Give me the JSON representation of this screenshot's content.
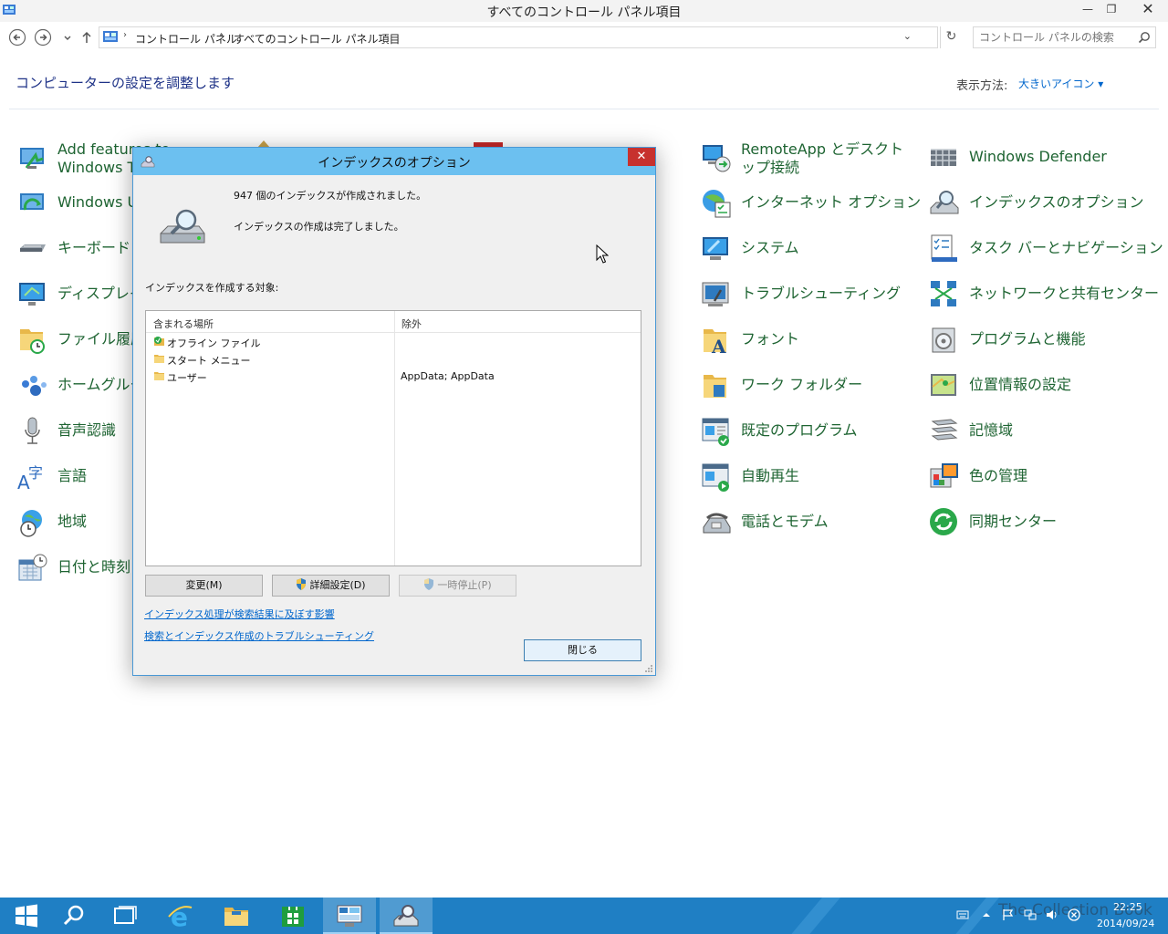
{
  "window": {
    "title": "すべてのコントロール パネル項目",
    "minimize": "—",
    "restore": "❐",
    "close": "✕"
  },
  "address": {
    "crumbs": [
      "コントロール パネル",
      "すべてのコントロール パネル項目"
    ],
    "separator": "›",
    "search_placeholder": "コントロール パネルの検索"
  },
  "header": {
    "heading": "コンピューターの設定を調整します",
    "view_by_label": "表示方法:",
    "view_by_value": "大きいアイコン ▾"
  },
  "items_left": [
    {
      "label": "Add features to Windows Technical Pr",
      "icon": "add-features-icon"
    },
    {
      "label": "Windows Up",
      "icon": "windows-update-icon"
    },
    {
      "label": "キーボード",
      "icon": "keyboard-icon"
    },
    {
      "label": "ディスプレイ",
      "icon": "display-icon"
    },
    {
      "label": "ファイル履歴",
      "icon": "file-history-icon"
    },
    {
      "label": "ホームグループ",
      "icon": "homegroup-icon"
    },
    {
      "label": "音声認識",
      "icon": "microphone-icon"
    },
    {
      "label": "言語",
      "icon": "language-icon"
    },
    {
      "label": "地域",
      "icon": "region-icon"
    },
    {
      "label": "日付と時刻",
      "icon": "date-time-icon"
    }
  ],
  "items_col3": [
    {
      "label": "RemoteApp とデスクトップ接続",
      "icon": "remoteapp-icon"
    },
    {
      "label": "インターネット オプション",
      "icon": "internet-options-icon"
    },
    {
      "label": "システム",
      "icon": "system-icon"
    },
    {
      "label": "トラブルシューティング",
      "icon": "troubleshooting-icon"
    },
    {
      "label": "フォント",
      "icon": "fonts-icon"
    },
    {
      "label": "ワーク フォルダー",
      "icon": "work-folders-icon"
    },
    {
      "label": "既定のプログラム",
      "icon": "default-programs-icon"
    },
    {
      "label": "自動再生",
      "icon": "autoplay-icon"
    },
    {
      "label": "電話とモデム",
      "icon": "phone-modem-icon"
    }
  ],
  "items_col4": [
    {
      "label": "Windows Defender",
      "icon": "windows-defender-icon"
    },
    {
      "label": "インデックスのオプション",
      "icon": "indexing-options-icon"
    },
    {
      "label": "タスク バーとナビゲーション",
      "icon": "taskbar-navigation-icon"
    },
    {
      "label": "ネットワークと共有センター",
      "icon": "network-sharing-icon"
    },
    {
      "label": "プログラムと機能",
      "icon": "programs-features-icon"
    },
    {
      "label": "位置情報の設定",
      "icon": "location-settings-icon"
    },
    {
      "label": "記憶域",
      "icon": "storage-spaces-icon"
    },
    {
      "label": "色の管理",
      "icon": "color-management-icon"
    },
    {
      "label": "同期センター",
      "icon": "sync-center-icon"
    }
  ],
  "dialog": {
    "title": "インデックスのオプション",
    "close": "✕",
    "count_text": "947 個のインデックスが作成されました。",
    "status_text": "インデックスの作成は完了しました。",
    "target_label": "インデックスを作成する対象:",
    "columns": [
      "含まれる場所",
      "除外"
    ],
    "rows": [
      {
        "location": "オフライン ファイル",
        "exclude": ""
      },
      {
        "location": "スタート メニュー",
        "exclude": ""
      },
      {
        "location": "ユーザー",
        "exclude": "AppData; AppData"
      }
    ],
    "btn_modify": "変更(M)",
    "btn_advanced": "詳細設定(D)",
    "btn_pause": "一時停止(P)",
    "link_effect": "インデックス処理が検索結果に及ぼす影響",
    "link_troubleshoot": "検索とインデックス作成のトラブルシューティング",
    "btn_close": "閉じる"
  },
  "taskbar": {
    "watermark": "The Collection Book",
    "time": "22:25",
    "date": "2014/09/24"
  },
  "colors": {
    "item_label": "#1e6432",
    "heading": "#1e3287",
    "link": "#0066cc",
    "dialog_title": "#6cc0f0",
    "close_red": "#c7312e",
    "taskbar": "#1f7fc4"
  }
}
